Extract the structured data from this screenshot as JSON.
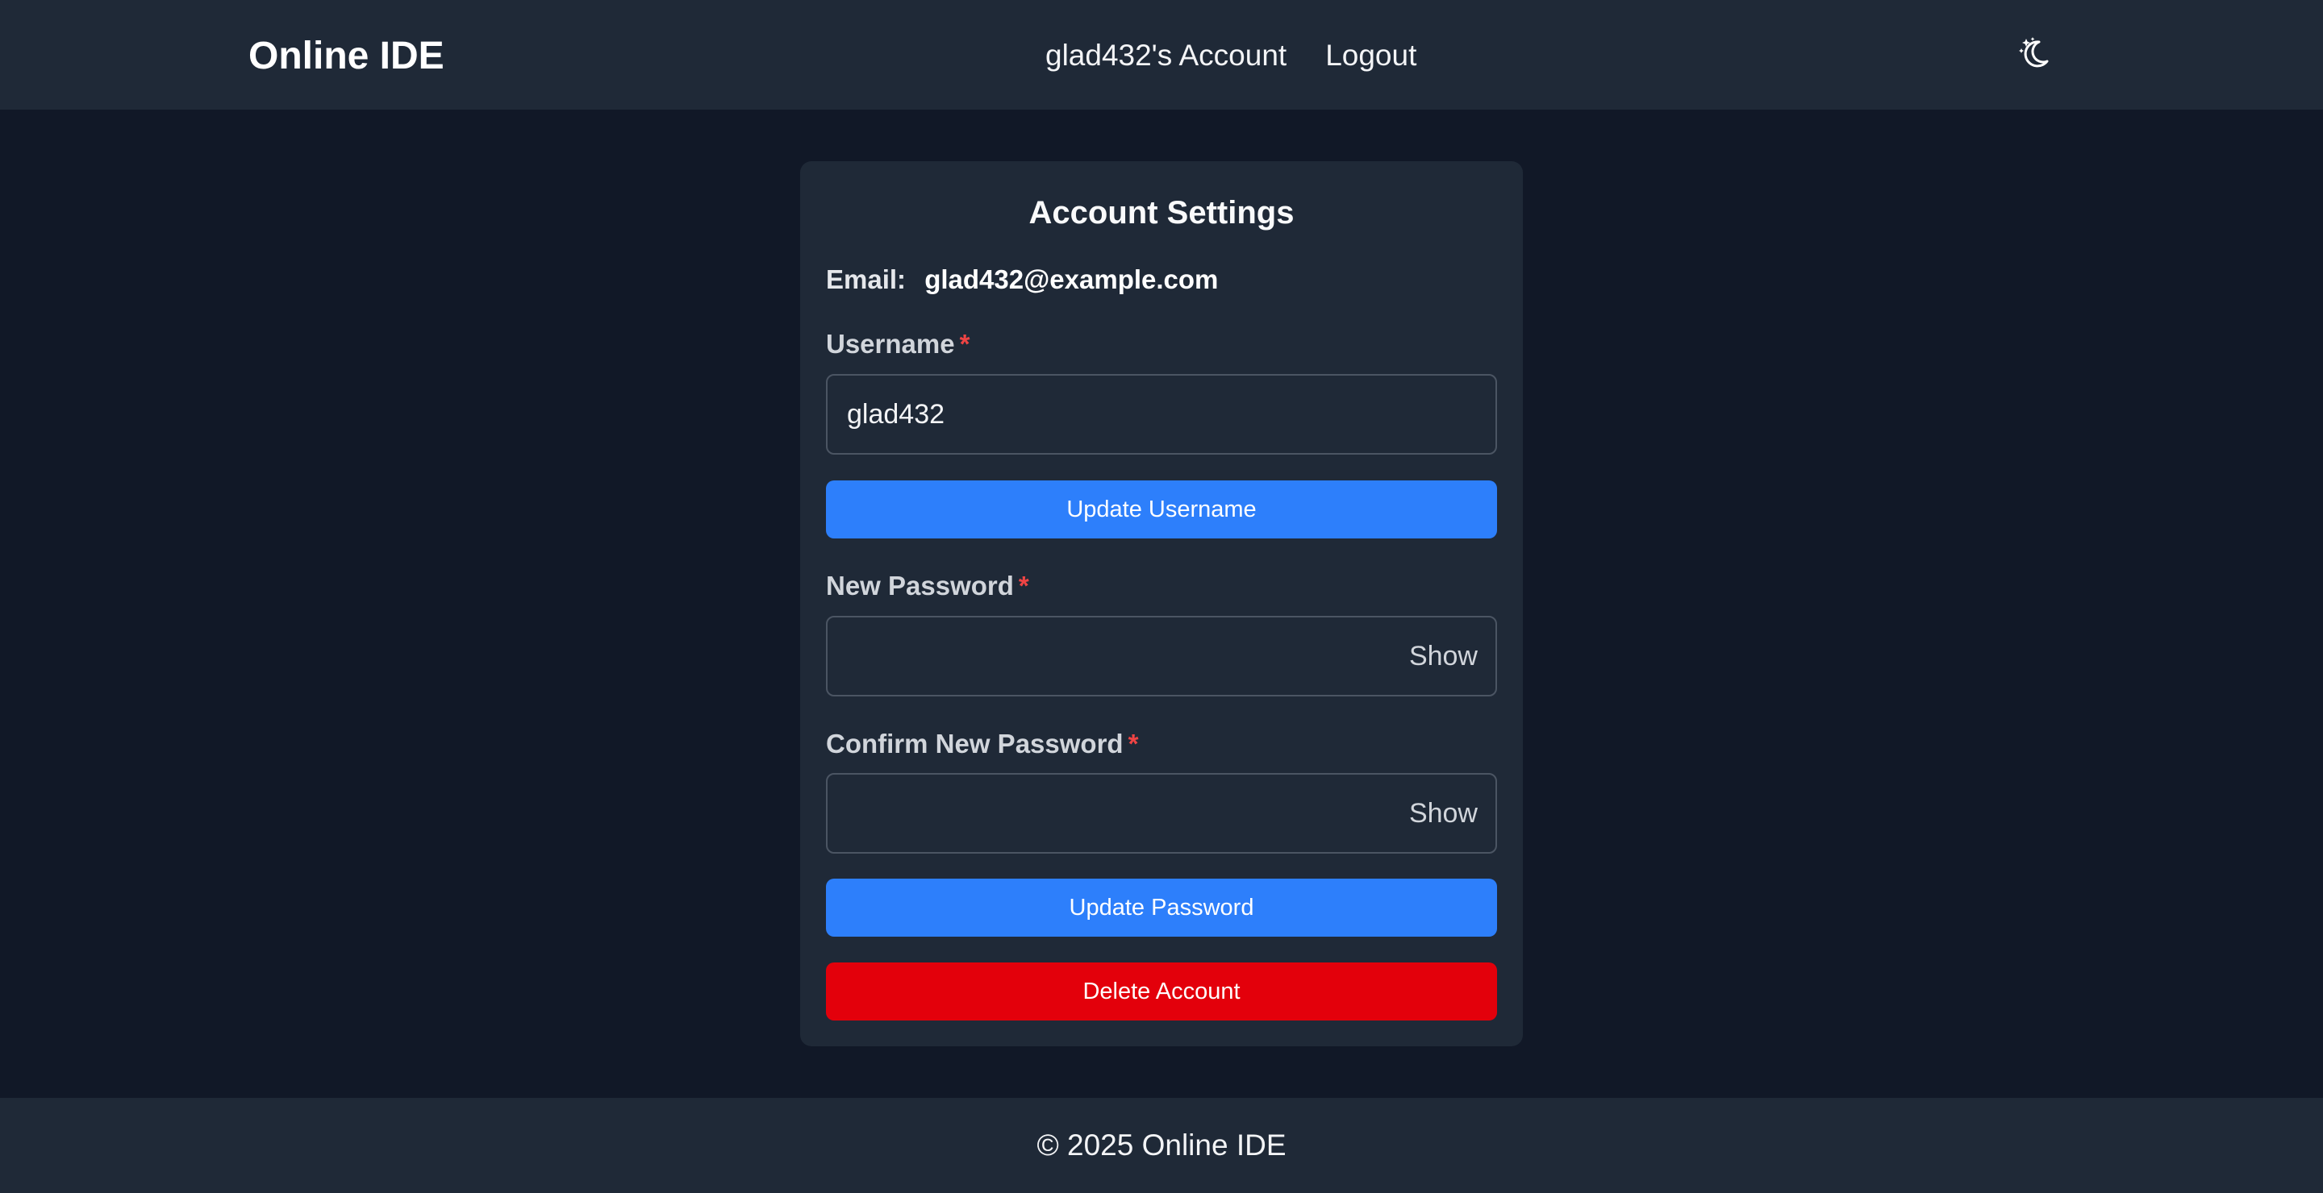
{
  "app": {
    "brand": "Online IDE",
    "theme_icon": "moon-stars-icon"
  },
  "nav": {
    "account_link": "glad432's Account",
    "logout_link": "Logout"
  },
  "settings": {
    "title": "Account Settings",
    "email_label": "Email:",
    "email_value": "glad432@example.com",
    "username": {
      "label": "Username",
      "required_mark": "*",
      "value": "glad432",
      "button": "Update Username"
    },
    "new_password": {
      "label": "New Password",
      "required_mark": "*",
      "value": "",
      "toggle": "Show"
    },
    "confirm_password": {
      "label": "Confirm New Password",
      "required_mark": "*",
      "value": "",
      "toggle": "Show"
    },
    "update_password_button": "Update Password",
    "delete_account_button": "Delete Account"
  },
  "footer": {
    "text": "© 2025 Online IDE"
  },
  "colors": {
    "background": "#111827",
    "surface": "#1f2937",
    "primary": "#2d7ffb",
    "danger": "#e3000b",
    "required": "#ef4444"
  }
}
